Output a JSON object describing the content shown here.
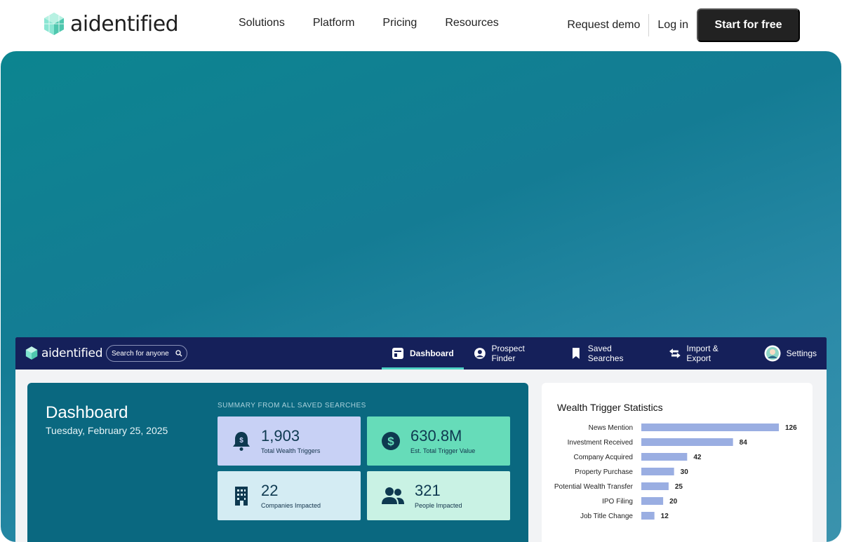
{
  "site": {
    "logo_text": "aidentified",
    "nav": [
      "Solutions",
      "Platform",
      "Pricing",
      "Resources"
    ],
    "request_demo": "Request demo",
    "login": "Log in",
    "start": "Start for free"
  },
  "app": {
    "logo_text": "aidentified",
    "search_placeholder": "Search for anyone",
    "tabs": [
      {
        "label": "Dashboard",
        "icon": "dashboard-icon",
        "active": true
      },
      {
        "label": "Prospect Finder",
        "icon": "user-circle-icon",
        "active": false
      },
      {
        "label": "Saved Searches",
        "icon": "bookmark-icon",
        "active": false
      },
      {
        "label": "Import & Export",
        "icon": "swap-arrows-icon",
        "active": false
      },
      {
        "label": "Settings",
        "icon": "avatar-icon",
        "active": false
      }
    ],
    "dashboard": {
      "title": "Dashboard",
      "date": "Tuesday, February 25, 2025",
      "summary_label": "SUMMARY FROM ALL SAVED SEARCHES",
      "stats": [
        {
          "value": "1,903",
          "label": "Total Wealth Triggers",
          "icon": "bell-dollar-icon"
        },
        {
          "value": "630.8M",
          "label": "Est. Total Trigger Value",
          "icon": "dollar-circle-icon"
        },
        {
          "value": "22",
          "label": "Companies Impacted",
          "icon": "building-icon"
        },
        {
          "value": "321",
          "label": "People Impacted",
          "icon": "people-icon"
        }
      ]
    },
    "stats_title": "Wealth Trigger Statistics"
  },
  "colors": {
    "accent": "#4fd1c5",
    "bar": "#9aaee2",
    "appbar": "#15205a",
    "panel": "#0a6880"
  },
  "chart_data": {
    "type": "bar",
    "orientation": "horizontal",
    "title": "Wealth Trigger Statistics",
    "categories": [
      "News Mention",
      "Investment Received",
      "Company Acquired",
      "Property Purchase",
      "Potential Wealth Transfer",
      "IPO Filing",
      "Job Title Change"
    ],
    "values": [
      126,
      84,
      42,
      30,
      25,
      20,
      12
    ],
    "grid": false
  }
}
